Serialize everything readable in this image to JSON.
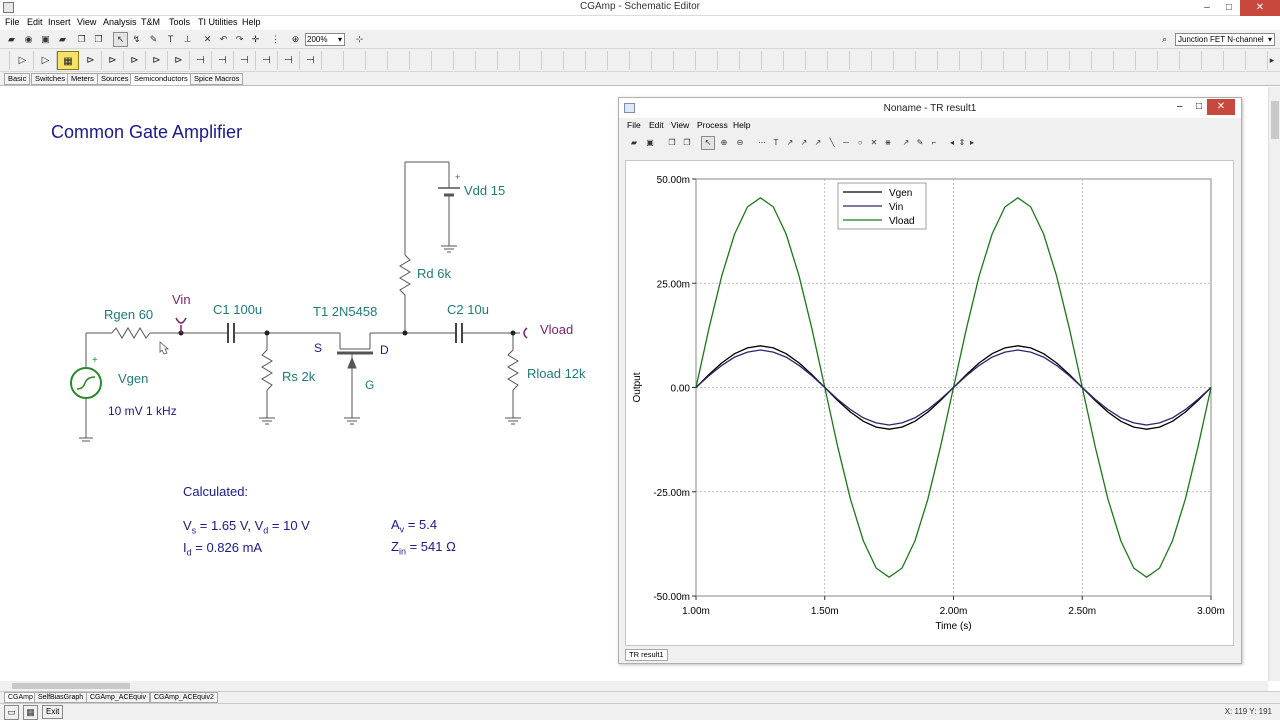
{
  "window": {
    "title": "CGAmp - Schematic Editor",
    "minimize": "–",
    "maximize": "□",
    "close": "✕"
  },
  "menu": [
    "File",
    "Edit",
    "Insert",
    "View",
    "Analysis",
    "T&M",
    "Tools",
    "TI Utilities",
    "Help"
  ],
  "toolbar": {
    "zoom": "200%",
    "component": "Junction FET N-channel"
  },
  "palette_tabs": [
    "Basic",
    "Switches",
    "Meters",
    "Sources",
    "Semiconductors",
    "Spice Macros"
  ],
  "palette_selected": "Semiconductors",
  "schematic": {
    "title": "Common Gate Amplifier",
    "components": {
      "vdd": "Vdd 15",
      "rd": "Rd 6k",
      "rgen": "Rgen 60",
      "vin": "Vin",
      "c1": "C1 100u",
      "t1": "T1 2N5458",
      "c2": "C2 10u",
      "vload": "Vload",
      "s": "S",
      "d": "D",
      "g": "G",
      "rs": "Rs 2k",
      "rload": "Rload 12k",
      "vgen": "Vgen",
      "vgen_value": "10 mV 1 kHz"
    },
    "calculated": {
      "heading": "Calculated:",
      "vs_label": "V",
      "vs_sub": "s",
      "vs_text": " = 1.65 V, V",
      "vd_sub": "d",
      "vd_text": " = 10 V",
      "id_label": "I",
      "id_sub": "d",
      "id_text": " = 0.826 mA",
      "av_label": "A",
      "av_sub": "v",
      "av_text": " = 5.4",
      "zin_label": "Z",
      "zin_sub": "in",
      "zin_text": " = 541 Ω"
    }
  },
  "result_window": {
    "title": "Noname - TR result1",
    "menu": [
      "File",
      "Edit",
      "View",
      "Process",
      "Help"
    ],
    "tab": "TR result1"
  },
  "doc_tabs": [
    "CGAmp",
    "SelfBiasGraph",
    "CGAmp_ACEquiv",
    "CGAmp_ACEquiv2"
  ],
  "status": {
    "exit": "Exit",
    "coords": "X: 119  Y: 191"
  },
  "colors": {
    "schematic_text": "#1a1a8c",
    "component_label": "#1f7a7a",
    "wire": "#555555",
    "vin_marker": "#7a1f6e",
    "accent_palette": "#f6e26a"
  },
  "chart_data": {
    "type": "line",
    "xlabel": "Time (s)",
    "ylabel": "Output",
    "x_ticks": [
      "1.00m",
      "1.50m",
      "2.00m",
      "2.50m",
      "3.00m"
    ],
    "y_ticks": [
      "50.00m",
      "25.00m",
      "0.00",
      "-25.00m",
      "-50.00m"
    ],
    "xlim": [
      0.001,
      0.003
    ],
    "ylim": [
      -0.05,
      0.05
    ],
    "grid": true,
    "legend_position": "top-center",
    "x": [
      0.001,
      0.00105,
      0.0011,
      0.00115,
      0.0012,
      0.00125,
      0.0013,
      0.00135,
      0.0014,
      0.00145,
      0.0015,
      0.00155,
      0.0016,
      0.00165,
      0.0017,
      0.00175,
      0.0018,
      0.00185,
      0.0019,
      0.00195,
      0.002,
      0.00205,
      0.0021,
      0.00215,
      0.0022,
      0.00225,
      0.0023,
      0.00235,
      0.0024,
      0.00245,
      0.0025,
      0.00255,
      0.0026,
      0.00265,
      0.0027,
      0.00275,
      0.0028,
      0.00285,
      0.0029,
      0.00295,
      0.003
    ],
    "series": [
      {
        "name": "Vgen",
        "color": "#000000",
        "values": [
          0,
          0.0031,
          0.0059,
          0.0081,
          0.0095,
          0.01,
          0.0095,
          0.0081,
          0.0059,
          0.0031,
          0,
          -0.0031,
          -0.0059,
          -0.0081,
          -0.0095,
          -0.01,
          -0.0095,
          -0.0081,
          -0.0059,
          -0.0031,
          0,
          0.0031,
          0.0059,
          0.0081,
          0.0095,
          0.01,
          0.0095,
          0.0081,
          0.0059,
          0.0031,
          0,
          -0.0031,
          -0.0059,
          -0.0081,
          -0.0095,
          -0.01,
          -0.0095,
          -0.0081,
          -0.0059,
          -0.0031,
          0
        ]
      },
      {
        "name": "Vin",
        "color": "#2a2a6e",
        "values": [
          0,
          0.0028,
          0.0053,
          0.0073,
          0.0085,
          0.009,
          0.0085,
          0.0073,
          0.0053,
          0.0028,
          0,
          -0.0028,
          -0.0053,
          -0.0073,
          -0.0085,
          -0.009,
          -0.0085,
          -0.0073,
          -0.0053,
          -0.0028,
          0,
          0.0028,
          0.0053,
          0.0073,
          0.0085,
          0.009,
          0.0085,
          0.0073,
          0.0053,
          0.0028,
          0,
          -0.0028,
          -0.0053,
          -0.0073,
          -0.0085,
          -0.009,
          -0.0085,
          -0.0073,
          -0.0053,
          -0.0028,
          0
        ]
      },
      {
        "name": "Vload",
        "color": "#1a7a1a",
        "values": [
          0,
          0.0141,
          0.0268,
          0.0368,
          0.0433,
          0.0455,
          0.0433,
          0.0368,
          0.0268,
          0.0141,
          0,
          -0.0141,
          -0.0268,
          -0.0368,
          -0.0433,
          -0.0455,
          -0.0433,
          -0.0368,
          -0.0268,
          -0.0141,
          0,
          0.0141,
          0.0268,
          0.0368,
          0.0433,
          0.0455,
          0.0433,
          0.0368,
          0.0268,
          0.0141,
          0,
          -0.0141,
          -0.0268,
          -0.0368,
          -0.0433,
          -0.0455,
          -0.0433,
          -0.0368,
          -0.0268,
          -0.0141,
          0
        ]
      }
    ]
  }
}
